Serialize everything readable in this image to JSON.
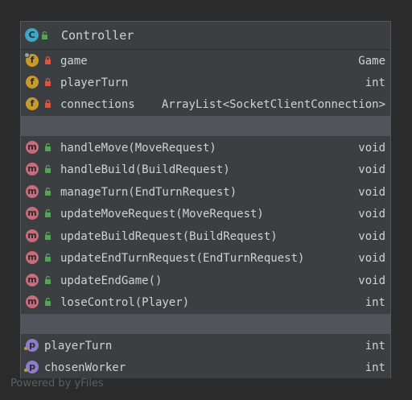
{
  "diagram": {
    "class_name": "Controller",
    "fields": [
      {
        "name": "game",
        "type": "Game",
        "icon": "field-icon",
        "visibility": "private"
      },
      {
        "name": "playerTurn",
        "type": "int",
        "icon": "field-icon",
        "visibility": "private"
      },
      {
        "name": "connections",
        "type": "ArrayList<SocketClientConnection>",
        "icon": "field-icon",
        "visibility": "private"
      }
    ],
    "methods": [
      {
        "name": "handleMove(MoveRequest)",
        "type": "void"
      },
      {
        "name": "handleBuild(BuildRequest)",
        "type": "void"
      },
      {
        "name": "manageTurn(EndTurnRequest)",
        "type": "void"
      },
      {
        "name": "updateMoveRequest(MoveRequest)",
        "type": "void"
      },
      {
        "name": "updateBuildRequest(BuildRequest)",
        "type": "void"
      },
      {
        "name": "updateEndTurnRequest(EndTurnRequest)",
        "type": "void"
      },
      {
        "name": "updateEndGame()",
        "type": "void"
      },
      {
        "name": "loseControl(Player)",
        "type": "int"
      }
    ],
    "properties": [
      {
        "name": "playerTurn",
        "type": "int"
      },
      {
        "name": "chosenWorker",
        "type": "int"
      }
    ]
  },
  "icons": {
    "class": "C",
    "field": "f",
    "method": "m",
    "property": "p"
  },
  "watermark": "Powered by yFiles",
  "colors": {
    "background": "#2b2b2b",
    "panel": "#3c3f41",
    "separator": "#51555a",
    "class_icon": "#3aa7c8",
    "field_icon": "#c79a2e",
    "method_icon": "#c86b7a",
    "property_icon": "#8d7cc8",
    "lock_private": "#d9553f",
    "lock_public": "#55a355"
  }
}
